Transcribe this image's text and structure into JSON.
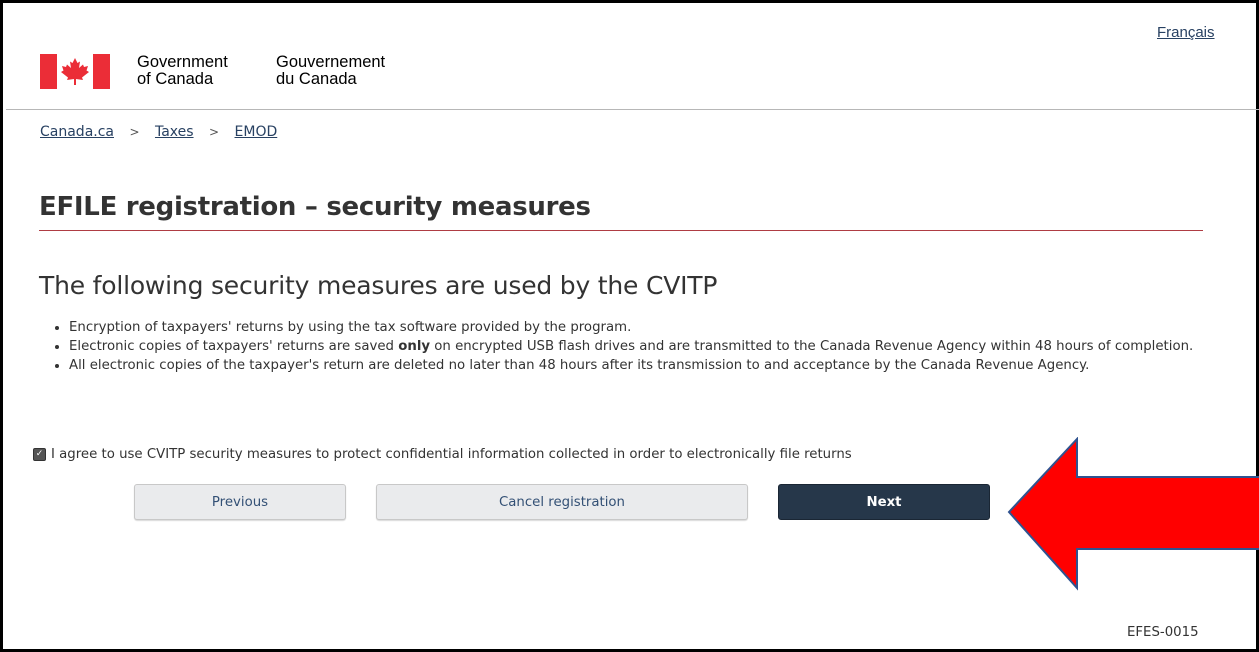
{
  "header": {
    "language_link": "Français",
    "wordmark_en": [
      "Government",
      "of Canada"
    ],
    "wordmark_fr": [
      "Gouvernement",
      "du Canada"
    ]
  },
  "breadcrumb": [
    "Canada.ca",
    "Taxes",
    "EMOD"
  ],
  "breadcrumb_separator": ">",
  "page_title": "EFILE registration – security measures",
  "section_title": "The following security measures are used by the CVITP",
  "measures": {
    "item1": "Encryption of taxpayers' returns by using the tax software provided by the program.",
    "item2_before": "Electronic copies of taxpayers' returns are saved ",
    "item2_bold": "only",
    "item2_after": " on encrypted USB flash drives and are transmitted to the Canada Revenue Agency within 48 hours of completion.",
    "item3": "All electronic copies of the taxpayer's return are deleted no later than 48 hours after its transmission to and acceptance by the Canada Revenue Agency."
  },
  "agreement": {
    "checked": true,
    "label": "I agree to use CVITP security measures to protect confidential information collected in order to electronically file returns"
  },
  "buttons": {
    "previous": "Previous",
    "cancel": "Cancel registration",
    "next": "Next"
  },
  "page_code": "EFES-0015",
  "colors": {
    "flag_red": "#eb2d37",
    "link_blue": "#284162",
    "title_rule": "#af3c43",
    "primary_button": "#26374a",
    "arrow_fill": "#ff0000",
    "arrow_stroke": "#2f528f"
  },
  "icons": {
    "flag": "canada-flag-icon",
    "checkbox": "checkbox-checked-icon",
    "arrow": "red-arrow-annotation"
  }
}
